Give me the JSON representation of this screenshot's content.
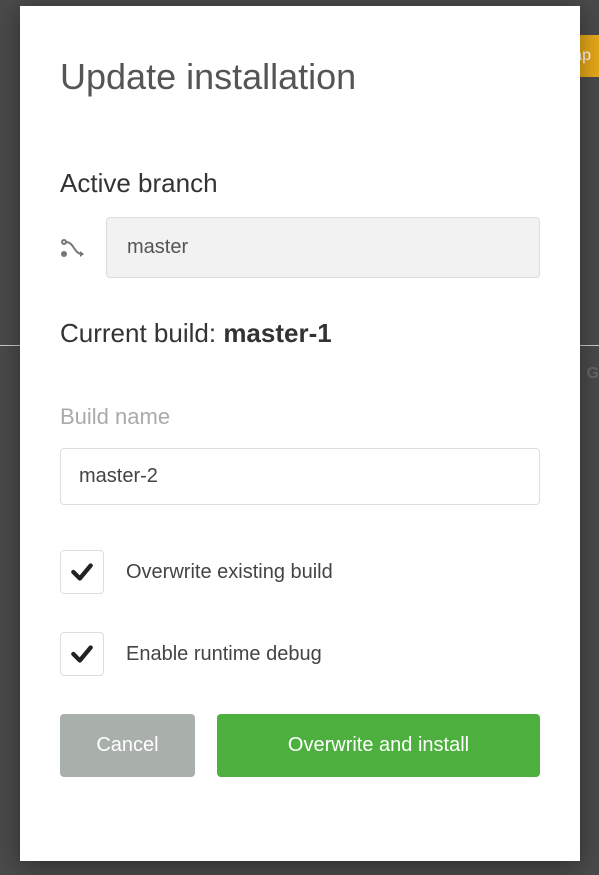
{
  "backdrop": {
    "partial_button_text": "ap",
    "partial_right_text": "G"
  },
  "modal": {
    "title": "Update installation",
    "active_branch_label": "Active branch",
    "branch_value": "master",
    "current_build_label": "Current build: ",
    "current_build_value": "master-1",
    "build_name_label": "Build name",
    "build_name_value": "master-2",
    "checkbox_overwrite_label": "Overwrite existing build",
    "checkbox_debug_label": "Enable runtime debug",
    "cancel_label": "Cancel",
    "submit_label": "Overwrite and install"
  }
}
